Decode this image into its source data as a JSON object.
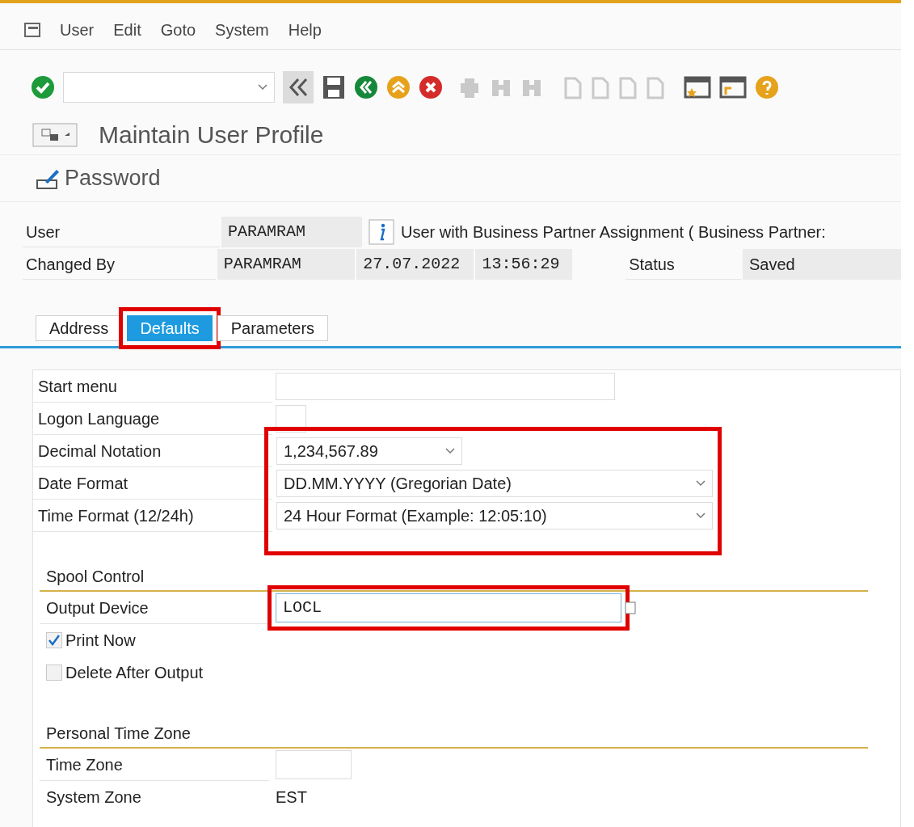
{
  "menu": [
    "User",
    "Edit",
    "Goto",
    "System",
    "Help"
  ],
  "title": "Maintain User Profile",
  "app_button": "Password",
  "header": {
    "user_label": "User",
    "user_value": "PARAMRAM",
    "user_info": "User with Business Partner Assignment ( Business Partner:",
    "changed_label": "Changed By",
    "changed_value": "PARAMRAM",
    "changed_date": "27.07.2022",
    "changed_time": "13:56:29",
    "status_label": "Status",
    "status_value": "Saved"
  },
  "tabs": [
    {
      "label": "Address",
      "selected": false,
      "highlighted": false
    },
    {
      "label": "Defaults",
      "selected": true,
      "highlighted": true
    },
    {
      "label": "Parameters",
      "selected": false,
      "highlighted": false
    }
  ],
  "fields": [
    {
      "label": "Start menu",
      "kind": "input",
      "highlighted": false
    },
    {
      "label": "Logon Language",
      "kind": "input",
      "highlighted": false
    },
    {
      "label": "Decimal Notation",
      "kind": "dropdown",
      "value": "1,234,567.89",
      "highlighted": true
    },
    {
      "label": "Date Format",
      "kind": "dropdown",
      "value": "DD.MM.YYYY (Gregorian Date)",
      "highlighted": true
    },
    {
      "label": "Time Format (12/24h)",
      "kind": "dropdown",
      "value": "24 Hour Format (Example: 12:05:10)",
      "highlighted": true
    }
  ],
  "sections": [
    {
      "title": "Spool Control",
      "items": [
        {
          "kind": "input",
          "label": "Output Device",
          "value": "LOCL",
          "highlighted": true
        },
        {
          "kind": "checkbox",
          "label": "Print Now",
          "checked": true
        },
        {
          "kind": "checkbox",
          "label": "Delete After Output",
          "checked": false
        }
      ]
    },
    {
      "title": "Personal Time Zone",
      "items": [
        {
          "kind": "input",
          "label": "Time Zone",
          "highlighted": false
        },
        {
          "kind": "text",
          "label": "System Zone",
          "value": "EST"
        }
      ]
    }
  ]
}
